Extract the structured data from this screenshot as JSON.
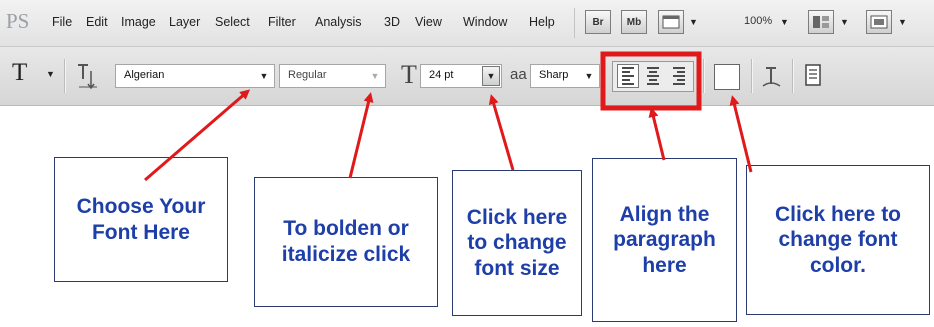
{
  "menubar": {
    "logo": "PS",
    "items": [
      "File",
      "Edit",
      "Image",
      "Layer",
      "Select",
      "Filter",
      "Analysis",
      "3D",
      "View",
      "Window",
      "Help"
    ],
    "bridge_label": "Br",
    "minibridge_label": "Mb",
    "zoom": "100%"
  },
  "options": {
    "tool_glyph": "T",
    "font_family": "Algerian",
    "font_style": "Regular",
    "font_size": "24 pt",
    "aa_glyph": "aa",
    "antialias": "Sharp"
  },
  "callouts": {
    "font": "Choose Your\nFont Here",
    "style": "To bolden or\nitalicize click",
    "size": "Click here\nto change\nfont size",
    "align": "Align the\nparagraph\nhere",
    "color": "Click here to\nchange font\ncolor."
  },
  "colors": {
    "arrow": "#e0191b",
    "highlight": "#e0191b",
    "callout_text": "#1f3fa8",
    "callout_border": "#2b3a73",
    "text_color_swatch": "#ffffff"
  }
}
